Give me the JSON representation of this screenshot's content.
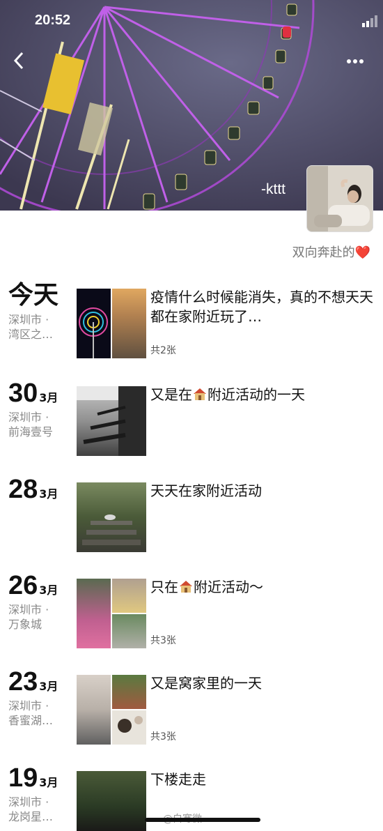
{
  "status": {
    "time": "20:52"
  },
  "profile": {
    "username": "-kttt",
    "signature": "双向奔赴的",
    "heart": "❤️"
  },
  "posts": [
    {
      "date": "今天",
      "month": "",
      "location_line1": "深圳市 ·",
      "location_line2": "湾区之…",
      "text": "疫情什么时候能消失，真的不想天天都在家附近玩了…",
      "count": "共2张"
    },
    {
      "date": "30",
      "month": "3月",
      "location_line1": "深圳市 ·",
      "location_line2": "前海壹号",
      "text_before": "又是在",
      "text_after": "附近活动的一天",
      "count": ""
    },
    {
      "date": "28",
      "month": "3月",
      "location_line1": "",
      "location_line2": "",
      "text": "天天在家附近活动",
      "count": ""
    },
    {
      "date": "26",
      "month": "3月",
      "location_line1": "深圳市 ·",
      "location_line2": "万象城",
      "text_before": "只在",
      "text_after": "附近活动～",
      "count": "共3张"
    },
    {
      "date": "23",
      "month": "3月",
      "location_line1": "深圳市 ·",
      "location_line2": "香蜜湖…",
      "text": "又是窝家里的一天",
      "count": "共3张"
    },
    {
      "date": "19",
      "month": "3月",
      "location_line1": "深圳市 ·",
      "location_line2": "龙岗星…",
      "text": "下楼走走",
      "count": ""
    }
  ],
  "watermark": "@白寒微",
  "icons": {
    "back": "chevron-left-icon",
    "more": "more-dots-icon",
    "home": "house-emoji-icon"
  }
}
